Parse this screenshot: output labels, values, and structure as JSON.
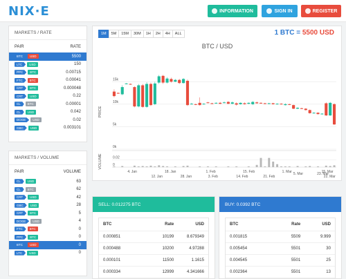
{
  "header": {
    "logo": "NIX·E",
    "buttons": {
      "information": "INFORMATION",
      "signin": "SIGN IN",
      "register": "REGISTER"
    }
  },
  "colors": {
    "accent": "#2f7ad0",
    "green": "#1fbc9c",
    "red": "#e84c3d",
    "gray": "#9aa3ab"
  },
  "rates": {
    "title": "MARKETS / RATE",
    "col_pair": "PAIR",
    "col_value": "RATE",
    "rows": [
      {
        "a": "BTC",
        "b": "USD",
        "bcolor": "red",
        "value": "5500",
        "selected": true
      },
      {
        "a": "LTC",
        "b": "USD",
        "bcolor": "green",
        "value": "150"
      },
      {
        "a": "PPC",
        "b": "BTC",
        "bcolor": "green",
        "value": "0.00715"
      },
      {
        "a": "FTC",
        "b": "BTC",
        "bcolor": "red",
        "value": "0.00041"
      },
      {
        "a": "CRT",
        "b": "BTC",
        "bcolor": "green",
        "value": "0.000048"
      },
      {
        "a": "CRT",
        "b": "USD",
        "bcolor": "green",
        "value": "0.22"
      },
      {
        "a": "CL",
        "b": "BTC",
        "bcolor": "gray",
        "value": "0.00001"
      },
      {
        "a": "CL",
        "b": "USD",
        "bcolor": "green",
        "value": "0.042"
      },
      {
        "a": "DOGE",
        "b": "USD",
        "bcolor": "gray",
        "value": "0.02"
      },
      {
        "a": "GBC",
        "b": "USD",
        "bcolor": "green",
        "value": "0.003101"
      }
    ]
  },
  "volume": {
    "title": "MARKETS / VOLUME",
    "col_pair": "PAIR",
    "col_value": "VOLUME",
    "rows": [
      {
        "a": "CL",
        "b": "USD",
        "bcolor": "green",
        "value": "63"
      },
      {
        "a": "CL",
        "b": "BTC",
        "bcolor": "gray",
        "value": "62"
      },
      {
        "a": "CRT",
        "b": "USD",
        "bcolor": "green",
        "value": "42"
      },
      {
        "a": "GBC",
        "b": "USD",
        "bcolor": "green",
        "value": "28"
      },
      {
        "a": "CRT",
        "b": "BTC",
        "bcolor": "green",
        "value": "5"
      },
      {
        "a": "DOGE",
        "b": "USD",
        "bcolor": "gray",
        "value": "4"
      },
      {
        "a": "FTC",
        "b": "BTC",
        "bcolor": "red",
        "value": "0"
      },
      {
        "a": "PPC",
        "b": "BTC",
        "bcolor": "green",
        "value": "0"
      },
      {
        "a": "BTC",
        "b": "USD",
        "bcolor": "red",
        "value": "0",
        "selected": true
      },
      {
        "a": "LTC",
        "b": "USD",
        "bcolor": "green",
        "value": "0"
      }
    ]
  },
  "chart": {
    "ranges": [
      "1M",
      "5M",
      "15M",
      "30M",
      "1H",
      "2H",
      "4H",
      "ALL"
    ],
    "active_range": "1M",
    "price_prefix": "1 BTC =",
    "price_value": "5500 USD"
  },
  "chart_data": {
    "type": "candlestick",
    "title": "BTC / USD",
    "ylabel": "PRICE",
    "ylabel_volume": "VOLUME",
    "yticks": [
      "15k",
      "10k",
      "5k",
      "0k"
    ],
    "ylim": [
      0,
      17500
    ],
    "volume_ticks": [
      "0.02",
      "0"
    ],
    "xticks_top": [
      "4. Jan",
      "18. Jan",
      "1. Feb",
      "15. Feb",
      "1. Mar",
      "15. Mar"
    ],
    "xticks_bottom": [
      "28. Jan",
      "3. Feb",
      "14. Feb",
      "21. Feb",
      "22. Mar"
    ],
    "xticks_other": [
      "12. Jan",
      "5. Mar",
      "23. Mar"
    ],
    "candles": [
      {
        "o": 12800,
        "c": 11800,
        "h": 13300,
        "l": 11500,
        "v": 0.002
      },
      {
        "o": 12500,
        "c": 12400,
        "h": 12600,
        "l": 12300,
        "v": 0.0
      },
      {
        "o": 12200,
        "c": 13800,
        "h": 14200,
        "l": 12000,
        "v": 0.003
      },
      {
        "o": 14500,
        "c": 14600,
        "h": 14700,
        "l": 14400,
        "v": 0.0
      },
      {
        "o": 14500,
        "c": 14400,
        "h": 14600,
        "l": 14300,
        "v": 0.0
      },
      {
        "o": 13800,
        "c": 9500,
        "h": 14000,
        "l": 9300,
        "v": 0.004
      },
      {
        "o": 9500,
        "c": 14200,
        "h": 14500,
        "l": 9300,
        "v": 0.002
      },
      {
        "o": 14200,
        "c": 9400,
        "h": 14500,
        "l": 9200,
        "v": 0.003
      },
      {
        "o": 9400,
        "c": 14500,
        "h": 14900,
        "l": 9200,
        "v": 0.002
      },
      {
        "o": 14500,
        "c": 9800,
        "h": 14800,
        "l": 9600,
        "v": 0.004
      },
      {
        "o": 10000,
        "c": 14600,
        "h": 15000,
        "l": 9800,
        "v": 0.002
      },
      {
        "o": 14800,
        "c": 16200,
        "h": 16500,
        "l": 14500,
        "v": 0.005
      },
      {
        "o": 16300,
        "c": 14800,
        "h": 16500,
        "l": 14500,
        "v": 0.003
      },
      {
        "o": 14800,
        "c": 15700,
        "h": 16000,
        "l": 14600,
        "v": 0.002
      },
      {
        "o": 15600,
        "c": 15000,
        "h": 15900,
        "l": 14800,
        "v": 0.0
      },
      {
        "o": 15000,
        "c": 15400,
        "h": 15600,
        "l": 14900,
        "v": 0.002
      },
      {
        "o": 15400,
        "c": 14700,
        "h": 15600,
        "l": 14500,
        "v": 0.0
      },
      {
        "o": 14700,
        "c": 15600,
        "h": 15800,
        "l": 14600,
        "v": 0.003
      },
      {
        "o": 15200,
        "c": 9800,
        "h": 15500,
        "l": 9600,
        "v": 0.004
      },
      {
        "o": 10000,
        "c": 10100,
        "h": 10300,
        "l": 9900,
        "v": 0.0
      },
      {
        "o": 10000,
        "c": 9900,
        "h": 10100,
        "l": 9800,
        "v": 0.0
      },
      {
        "o": 10300,
        "c": 9800,
        "h": 11500,
        "l": 9700,
        "v": 0.002
      },
      {
        "o": 10000,
        "c": 10100,
        "h": 10200,
        "l": 9900,
        "v": 0.0
      },
      {
        "o": 10400,
        "c": 10300,
        "h": 10500,
        "l": 10200,
        "v": 0.002
      },
      {
        "o": 10200,
        "c": 10100,
        "h": 10300,
        "l": 10000,
        "v": 0.0
      },
      {
        "o": 10200,
        "c": 10300,
        "h": 10400,
        "l": 10100,
        "v": 0.002
      },
      {
        "o": 10300,
        "c": 10100,
        "h": 10500,
        "l": 10000,
        "v": 0.0
      },
      {
        "o": 10300,
        "c": 10400,
        "h": 10600,
        "l": 10200,
        "v": 0.0
      },
      {
        "o": 10500,
        "c": 10100,
        "h": 10700,
        "l": 10000,
        "v": 0.002
      },
      {
        "o": 10100,
        "c": 10400,
        "h": 10600,
        "l": 10000,
        "v": 0.0
      },
      {
        "o": 10200,
        "c": 9900,
        "h": 10400,
        "l": 9700,
        "v": 0.002
      },
      {
        "o": 10000,
        "c": 10300,
        "h": 10400,
        "l": 9900,
        "v": 0.0
      },
      {
        "o": 10200,
        "c": 10000,
        "h": 10400,
        "l": 9900,
        "v": 0.0
      },
      {
        "o": 10100,
        "c": 10300,
        "h": 10400,
        "l": 10000,
        "v": 0.002
      },
      {
        "o": 10000,
        "c": 10500,
        "h": 10700,
        "l": 9800,
        "v": 0.0
      },
      {
        "o": 10400,
        "c": 10200,
        "h": 10600,
        "l": 10100,
        "v": 0.006
      },
      {
        "o": 10300,
        "c": 10200,
        "h": 10400,
        "l": 10100,
        "v": 0.025
      },
      {
        "o": 10200,
        "c": 10100,
        "h": 10300,
        "l": 10000,
        "v": 0.002
      },
      {
        "o": 10100,
        "c": 10200,
        "h": 10300,
        "l": 10000,
        "v": 0.025
      },
      {
        "o": 10200,
        "c": 10000,
        "h": 10300,
        "l": 9900,
        "v": 0.015
      },
      {
        "o": 10000,
        "c": 10100,
        "h": 10200,
        "l": 9900,
        "v": 0.008
      },
      {
        "o": 10100,
        "c": 10000,
        "h": 10200,
        "l": 9900,
        "v": 0.002
      },
      {
        "o": 9800,
        "c": 10000,
        "h": 10200,
        "l": 9700,
        "v": 0.002
      },
      {
        "o": 10000,
        "c": 9900,
        "h": 10100,
        "l": 9800,
        "v": 0.002
      },
      {
        "o": 9800,
        "c": 9000,
        "h": 9900,
        "l": 8900,
        "v": 0.0
      },
      {
        "o": 9000,
        "c": 9200,
        "h": 9300,
        "l": 8900,
        "v": 0.003
      },
      {
        "o": 9100,
        "c": 9000,
        "h": 9200,
        "l": 8900,
        "v": 0.0
      },
      {
        "o": 9000,
        "c": 8700,
        "h": 9100,
        "l": 8600,
        "v": 0.002
      },
      {
        "o": 8700,
        "c": 8000,
        "h": 8800,
        "l": 7900,
        "v": 0.003
      },
      {
        "o": 8000,
        "c": 8100,
        "h": 8200,
        "l": 7900,
        "v": 0.0
      },
      {
        "o": 8100,
        "c": 7800,
        "h": 8200,
        "l": 7700,
        "v": 0.002
      },
      {
        "o": 7800,
        "c": 7900,
        "h": 8000,
        "l": 7700,
        "v": 0.0
      },
      {
        "o": 10200,
        "c": 7500,
        "h": 10400,
        "l": 7400,
        "v": 0.004
      },
      {
        "o": 7500,
        "c": 10300,
        "h": 10500,
        "l": 7400,
        "v": 0.003
      },
      {
        "o": 10000,
        "c": 5500,
        "h": 10200,
        "l": 5400,
        "v": 0.005
      }
    ]
  },
  "sell": {
    "title": "SELL: 0.012275 BTC",
    "cols": [
      "BTC",
      "Rate",
      "USD"
    ],
    "rows": [
      [
        "0.000851",
        "10199",
        "8.679349"
      ],
      [
        "0.000488",
        "10200",
        "4.97288"
      ],
      [
        "0.000101",
        "11500",
        "1.1615"
      ],
      [
        "0.000334",
        "12999",
        "4.341666"
      ]
    ]
  },
  "buy": {
    "title": "BUY: 0.0392 BTC",
    "cols": [
      "BTC",
      "Rate",
      "USD"
    ],
    "rows": [
      [
        "0.001815",
        "5509",
        "9.999"
      ],
      [
        "0.005454",
        "5501",
        "30"
      ],
      [
        "0.004545",
        "5501",
        "25"
      ],
      [
        "0.002364",
        "5501",
        "13"
      ]
    ]
  }
}
